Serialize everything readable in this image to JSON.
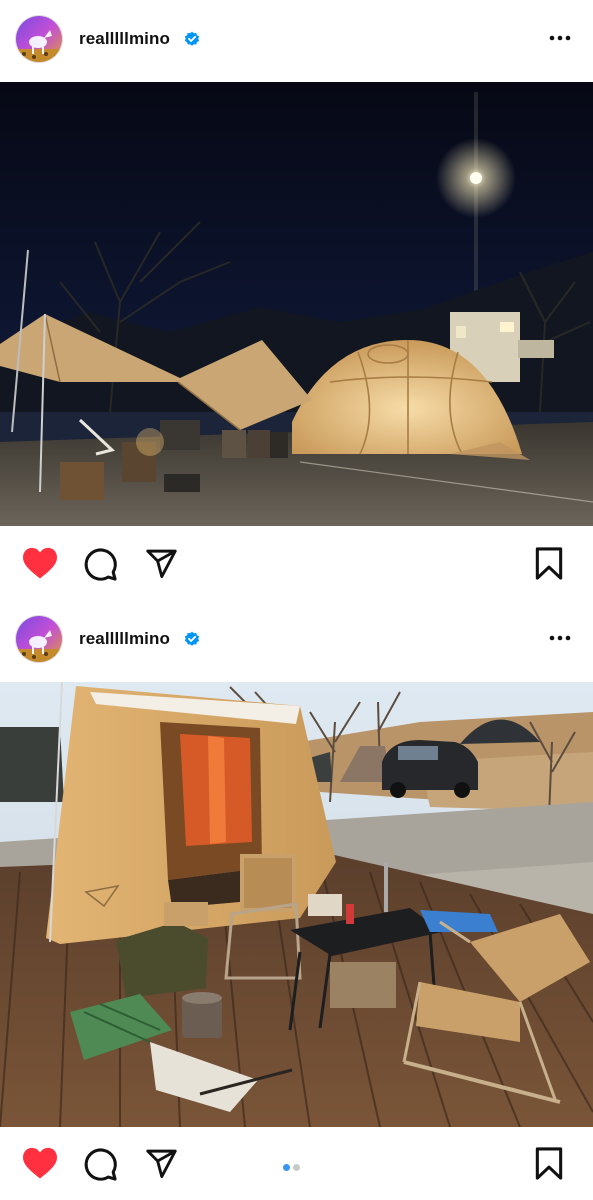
{
  "posts": [
    {
      "username": "realllllmino",
      "verified": true,
      "liked": true,
      "photo": "night camping scene with lit dome tent and tarp under moonlight",
      "carousel_dots": 0
    },
    {
      "username": "realllllmino",
      "verified": true,
      "liked": true,
      "photo": "canvas cabin tent on wooden deck with folding chairs and table in daylight",
      "carousel_dots": 2,
      "carousel_active": 0
    }
  ],
  "colors": {
    "like_red": "#ff3040",
    "verified_blue": "#0095f6",
    "dot_active": "#3897f0",
    "dot_inactive": "#c9c9c9"
  },
  "icons": [
    "heart-icon",
    "comment-icon",
    "share-icon",
    "bookmark-icon",
    "more-options-icon",
    "verified-badge-icon"
  ]
}
